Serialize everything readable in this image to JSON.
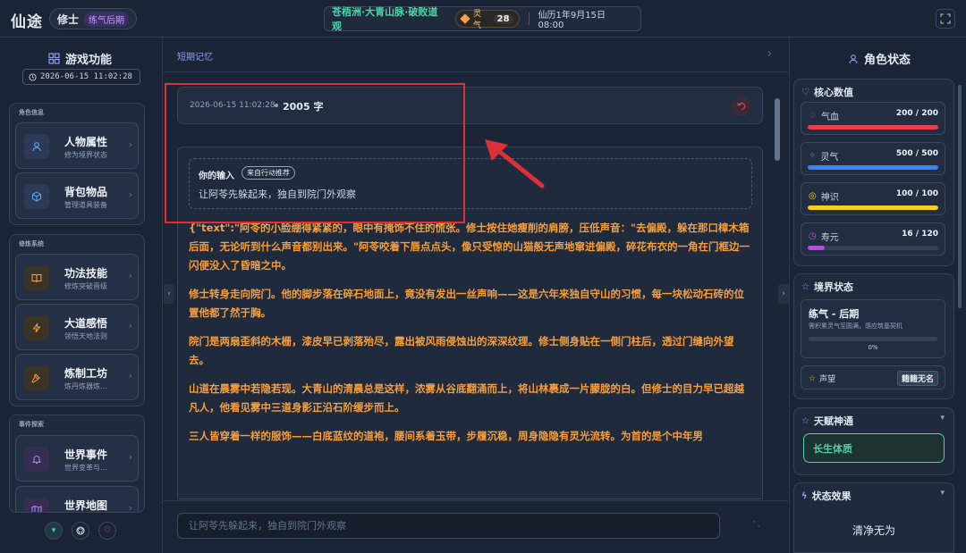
{
  "header": {
    "app_title": "仙途",
    "role_name": "修士",
    "role_realm": "练气后期",
    "location": "苍梧洲·大青山脉·破败道观",
    "qi_label": "灵气",
    "qi_value": "28",
    "game_time": "仙历1年9月15日 08:00"
  },
  "left_sidebar": {
    "title": "游戏功能",
    "datetime": "2026-06-15 11:02:28",
    "groups": [
      {
        "title": "角色信息",
        "items": [
          {
            "label": "人物属性",
            "sub": "修为境界状态",
            "icon": "person-icon"
          },
          {
            "label": "背包物品",
            "sub": "管理道具装备",
            "icon": "cube-icon"
          }
        ]
      },
      {
        "title": "修炼系统",
        "items": [
          {
            "label": "功法技能",
            "sub": "修炼突破晋级",
            "icon": "book-icon"
          },
          {
            "label": "大道感悟",
            "sub": "领悟天地法则",
            "icon": "lightning-icon"
          },
          {
            "label": "炼制工坊",
            "sub": "炼丹炼器炼...",
            "icon": "hammer-icon"
          }
        ]
      },
      {
        "title": "事件探索",
        "items": [
          {
            "label": "世界事件",
            "sub": "世界变革与...",
            "icon": "bell-icon"
          },
          {
            "label": "世界地图",
            "sub": "",
            "icon": "map-icon"
          }
        ]
      }
    ]
  },
  "center": {
    "tab_label": "短期记忆",
    "record_time": "2026-06-15 11:02:28",
    "word_count": "2005 字",
    "input_label": "你的输入",
    "input_source": "来自行动推荐",
    "input_text": "让阿苓先躲起来，独自到院门外观察",
    "story_paragraphs": [
      "{\"text\":\"阿苓的小脸绷得紧紧的，眼中有掩饰不住的慌张。修士按住她瘦削的肩膀，压低声音：\"去偏殿，躲在那口樟木箱后面，无论听到什么声音都别出来。\"阿苓咬着下唇点点头，像只受惊的山猫般无声地窜进偏殿，碎花布衣的一角在门框边一闪便没入了昏暗之中。",
      "修士转身走向院门。他的脚步落在碎石地面上，竟没有发出一丝声响——这是六年来独自守山的习惯，每一块松动石砖的位置他都了然于胸。",
      "院门是两扇歪斜的木栅，漆皮早已剥落殆尽，露出被风雨侵蚀出的深深纹理。修士侧身贴在一侧门柱后，透过门缝向外望去。",
      "山道在晨雾中若隐若现。大青山的清晨总是这样，浓雾从谷底翻涌而上，将山林裹成一片朦胧的白。但修士的目力早已超越凡人，他看见雾中三道身影正沿石阶缓步而上。",
      "三人皆穿着一样的服饰——白底蓝纹的道袍，腰间系着玉带，步履沉稳，周身隐隐有灵光流转。为首的是个中年男"
    ],
    "command_placeholder": "让阿苓先躲起来，独自到院门外观察"
  },
  "right_sidebar": {
    "title": "角色状态",
    "core_title": "核心数值",
    "stats": [
      {
        "label": "气血",
        "value": "200 / 200",
        "ratio": 1.0,
        "color": "#e53e4f",
        "icon": "blood-drop-icon"
      },
      {
        "label": "灵气",
        "value": "500 / 500",
        "ratio": 1.0,
        "color": "#3b82f6",
        "icon": "spirit-icon"
      },
      {
        "label": "神识",
        "value": "100 / 100",
        "ratio": 1.0,
        "color": "#f5d020",
        "icon": "mind-icon"
      },
      {
        "label": "寿元",
        "value": "16 / 120",
        "ratio": 0.133,
        "color": "#c046e8",
        "icon": "clock-icon"
      }
    ],
    "realm_title": "境界状态",
    "realm_name": "练气 - 后期",
    "realm_desc": "需积累灵气至圆满，感应筑基契机",
    "realm_progress": "0%",
    "fame_label": "声望",
    "fame_value": "籍籍无名",
    "talent_title": "天赋神通",
    "talent_name": "长生体质",
    "effects_title": "状态效果",
    "effects_text": "清净无为"
  },
  "colors": {
    "accent_green": "#4fd1a5",
    "story_orange": "#f59e3b",
    "annotation_red": "#dc2f38"
  }
}
